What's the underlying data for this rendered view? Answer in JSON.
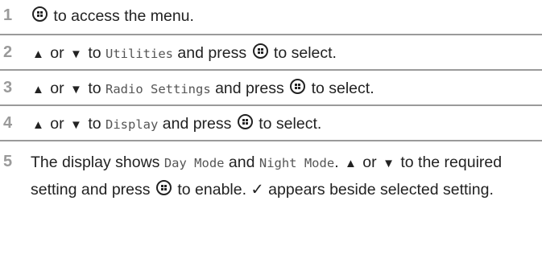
{
  "steps": [
    {
      "number": "1",
      "text_a": " to access the menu."
    },
    {
      "number": "2",
      "or": " or ",
      "to": " to ",
      "target": "Utilities",
      "press": " and press ",
      "end": " to select."
    },
    {
      "number": "3",
      "or": " or ",
      "to": " to ",
      "target": "Radio Settings",
      "press": " and press ",
      "end": " to select."
    },
    {
      "number": "4",
      "or": " or ",
      "to": " to ",
      "target": "Display",
      "press": " and press ",
      "end": " to select."
    },
    {
      "number": "5",
      "intro": "The display shows ",
      "mode1": "Day Mode",
      "and": " and ",
      "mode2": "Night Mode",
      "dot": ". ",
      "or": " or ",
      "to_line": " to the required setting and press ",
      "end": " to enable. ✓ appears beside selected setting."
    }
  ],
  "icons": {
    "ok_button": "ok-menu-button-icon",
    "up": "up-arrow-icon",
    "down": "down-arrow-icon"
  }
}
